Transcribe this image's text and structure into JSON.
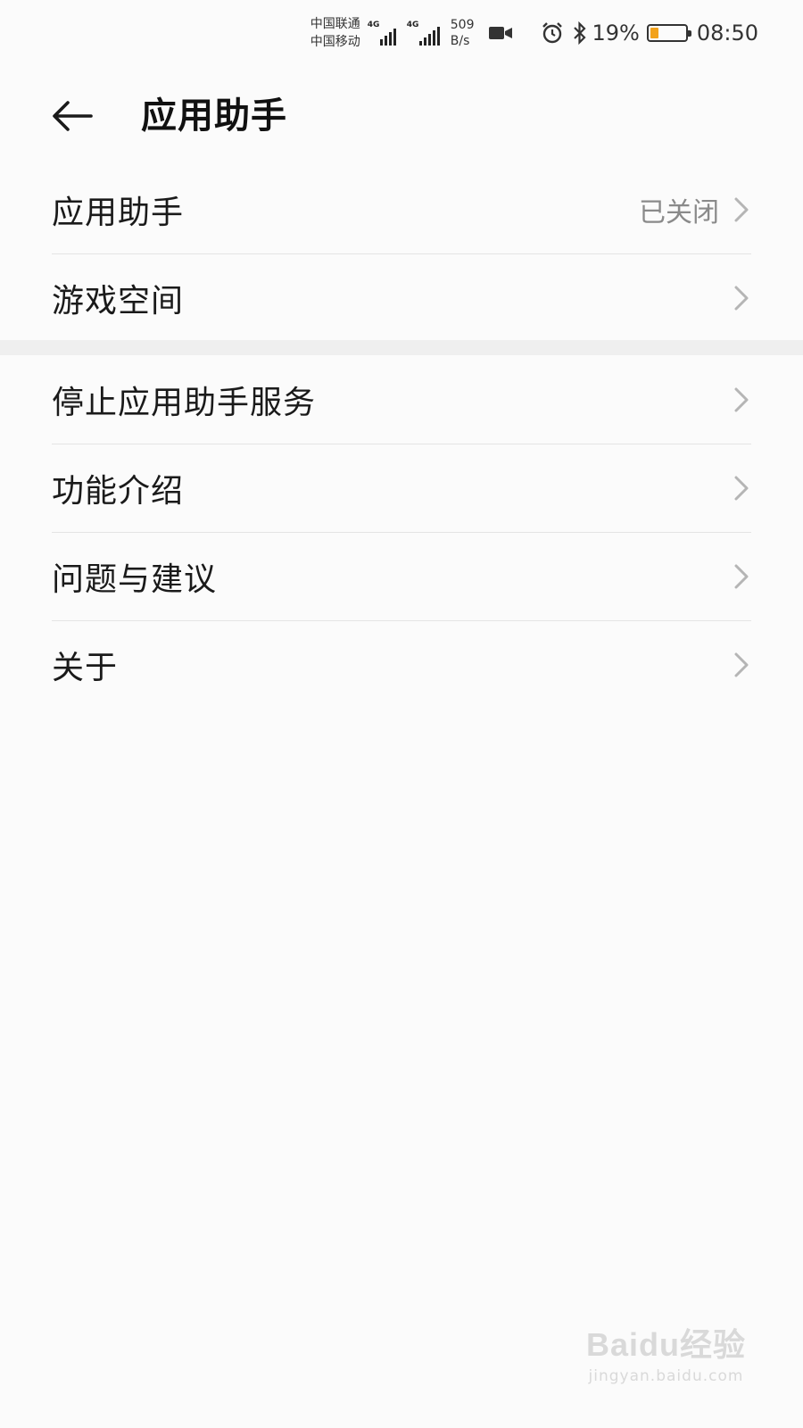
{
  "status_bar": {
    "carrier_1": "中国联通",
    "carrier_2": "中国移动",
    "network_1": "4G",
    "network_2": "4G",
    "speed_value": "509",
    "speed_unit": "B/s",
    "battery_percent": "19%",
    "battery_level": 0.19,
    "time": "08:50",
    "icons": [
      "video-icon",
      "alarm-icon",
      "bluetooth-icon",
      "battery-icon"
    ]
  },
  "header": {
    "back_icon": "arrow-left-icon",
    "title": "应用助手"
  },
  "settings": {
    "group_1": [
      {
        "label": "应用助手",
        "value": "已关闭"
      },
      {
        "label": "游戏空间",
        "value": ""
      }
    ],
    "group_2": [
      {
        "label": "停止应用助手服务"
      },
      {
        "label": "功能介绍"
      },
      {
        "label": "问题与建议"
      },
      {
        "label": "关于"
      }
    ]
  },
  "watermark": {
    "brand": "Baidu经验",
    "url": "jingyan.baidu.com"
  },
  "colors": {
    "background": "#fbfbfb",
    "divider": "#e4e4e4",
    "section_gap": "#efefef",
    "secondary_text": "#8a8a8a",
    "battery_fill": "#f2a21b"
  }
}
